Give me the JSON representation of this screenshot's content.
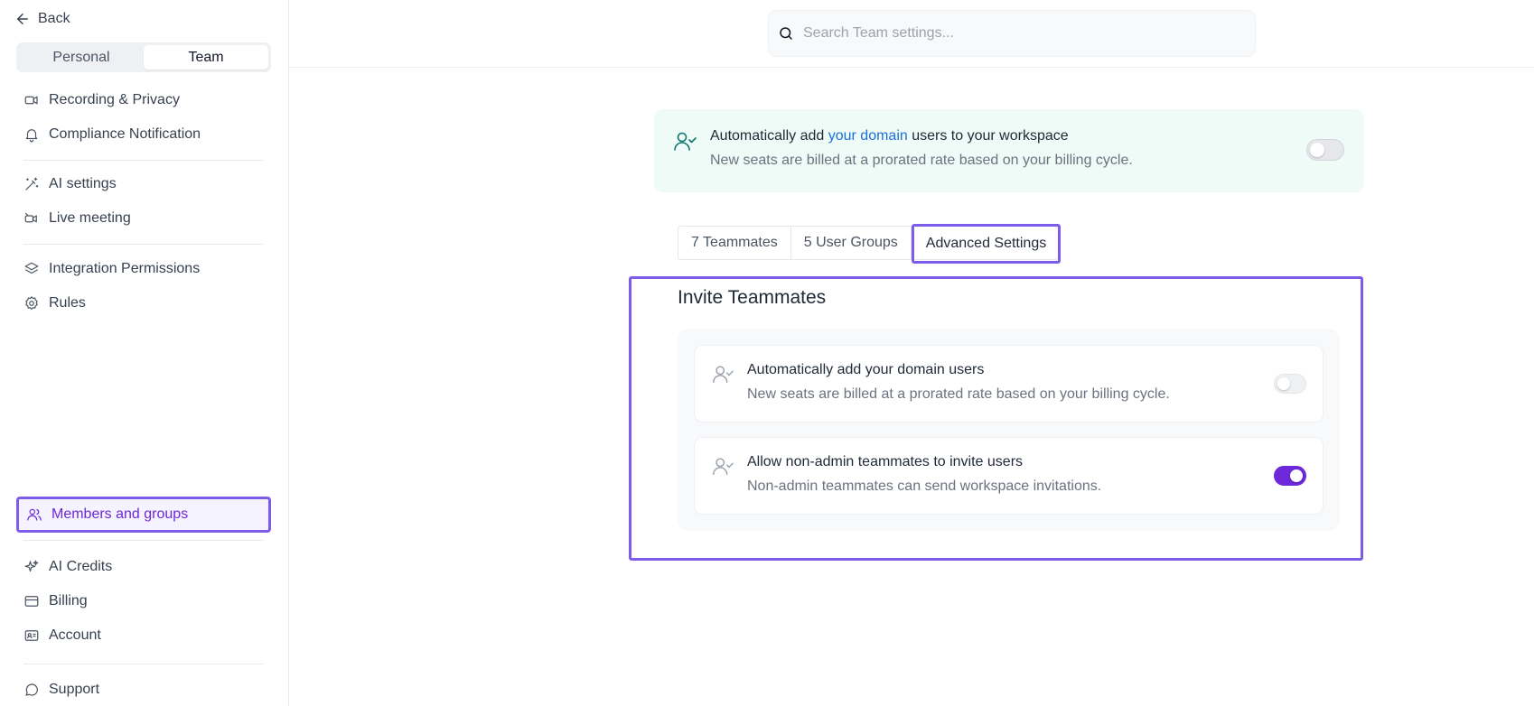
{
  "sidebar": {
    "back_label": "Back",
    "segments": {
      "personal": "Personal",
      "team": "Team"
    },
    "items": [
      {
        "label": "Recording & Privacy",
        "icon": "video-icon"
      },
      {
        "label": "Compliance Notification",
        "icon": "bell-icon"
      },
      {
        "label": "AI settings",
        "icon": "magic-wand-icon"
      },
      {
        "label": "Live meeting",
        "icon": "video-off-icon"
      },
      {
        "label": "Integration Permissions",
        "icon": "layers-icon"
      },
      {
        "label": "Rules",
        "icon": "gear-icon"
      },
      {
        "label": "Members and groups",
        "icon": "users-icon",
        "active": true
      },
      {
        "label": "AI Credits",
        "icon": "sparkles-icon"
      },
      {
        "label": "Billing",
        "icon": "credit-card-icon"
      },
      {
        "label": "Account",
        "icon": "id-card-icon"
      },
      {
        "label": "Support",
        "icon": "chat-bubble-icon"
      }
    ]
  },
  "search": {
    "placeholder": "Search Team settings..."
  },
  "banner": {
    "title_prefix": "Automatically add ",
    "title_link": "your domain",
    "title_suffix": " users to your workspace",
    "description": "New seats are billed at a prorated rate based on your billing cycle.",
    "toggle_on": false
  },
  "tabs": [
    {
      "label": "7 Teammates"
    },
    {
      "label": "5 User Groups"
    },
    {
      "label": "Advanced Settings",
      "active": true
    }
  ],
  "invite": {
    "title": "Invite Teammates",
    "settings": [
      {
        "title": "Automatically add your domain users",
        "description": "New seats are billed at a prorated rate based on your billing cycle.",
        "toggle_on": false
      },
      {
        "title": "Allow non-admin teammates to invite users",
        "description": "Non-admin teammates can send workspace invitations.",
        "toggle_on": true
      }
    ]
  },
  "colors": {
    "accent": "#6d28d9",
    "highlight_border": "#7c5ce8",
    "banner_bg": "#eefbf6",
    "link": "#1d6fd8"
  }
}
